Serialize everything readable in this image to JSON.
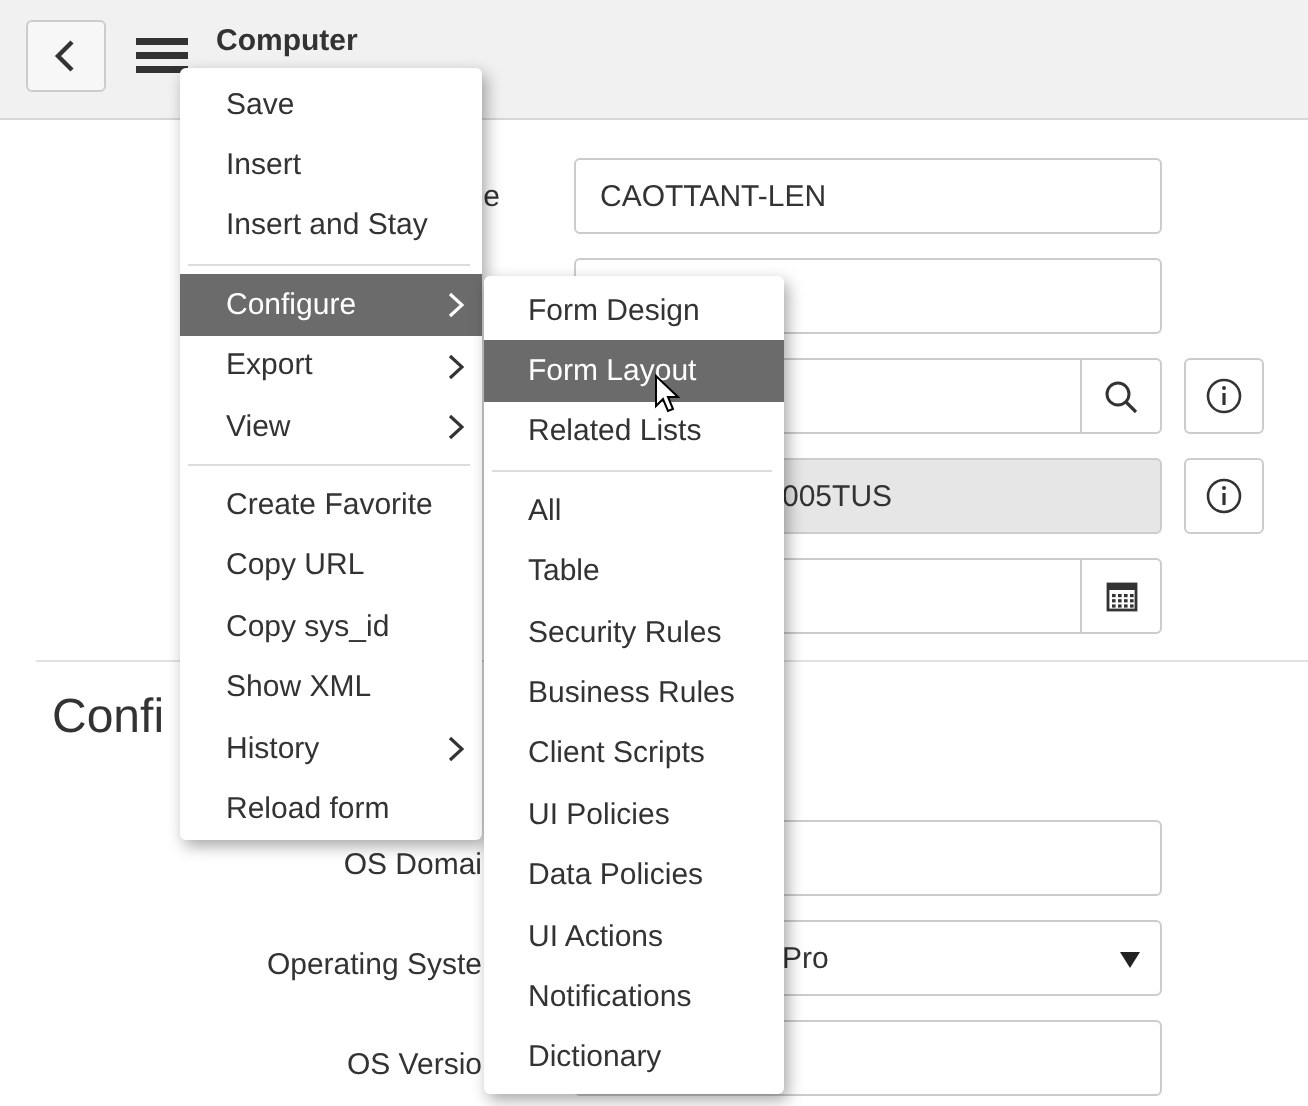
{
  "header": {
    "title": "Computer"
  },
  "form": {
    "rows": [
      {
        "kind": "text",
        "label": "e",
        "value": "CAOTTANT-LEN"
      },
      {
        "kind": "text"
      },
      {
        "kind": "lookup",
        "info": true
      },
      {
        "kind": "readonly",
        "value": "005TUS",
        "info": true
      },
      {
        "kind": "date"
      }
    ]
  },
  "section": {
    "title": "Confi",
    "rows": [
      {
        "kind": "text",
        "label": "OS Domai"
      },
      {
        "kind": "select",
        "label": "Operating Syste",
        "value": "Pro"
      },
      {
        "kind": "text",
        "label": "OS Versio"
      }
    ]
  },
  "context_menu": {
    "groups": [
      [
        {
          "label": "Save",
          "selected": false,
          "submenu": false
        },
        {
          "label": "Insert",
          "selected": false,
          "submenu": false
        },
        {
          "label": "Insert and Stay",
          "selected": false,
          "submenu": false
        }
      ],
      [
        {
          "label": "Configure",
          "selected": true,
          "submenu": true
        },
        {
          "label": "Export",
          "selected": false,
          "submenu": true
        },
        {
          "label": "View",
          "selected": false,
          "submenu": true
        }
      ],
      [
        {
          "label": "Create Favorite",
          "selected": false,
          "submenu": false
        },
        {
          "label": "Copy URL",
          "selected": false,
          "submenu": false
        },
        {
          "label": "Copy sys_id",
          "selected": false,
          "submenu": false
        },
        {
          "label": "Show XML",
          "selected": false,
          "submenu": false
        },
        {
          "label": "History",
          "selected": false,
          "submenu": true
        },
        {
          "label": "Reload form",
          "selected": false,
          "submenu": false
        }
      ]
    ]
  },
  "submenu": {
    "groups": [
      [
        {
          "label": "Form Design",
          "selected": false
        },
        {
          "label": "Form Layout",
          "selected": true
        },
        {
          "label": "Related Lists",
          "selected": false
        }
      ],
      [
        {
          "label": "All",
          "selected": false
        },
        {
          "label": "Table",
          "selected": false
        },
        {
          "label": "Security Rules",
          "selected": false
        },
        {
          "label": "Business Rules",
          "selected": false
        },
        {
          "label": "Client Scripts",
          "selected": false
        },
        {
          "label": "UI Policies",
          "selected": false
        },
        {
          "label": "Data Policies",
          "selected": false
        },
        {
          "label": "UI Actions",
          "selected": false
        },
        {
          "label": "Notifications",
          "selected": false
        },
        {
          "label": "Dictionary",
          "selected": false
        }
      ]
    ]
  }
}
